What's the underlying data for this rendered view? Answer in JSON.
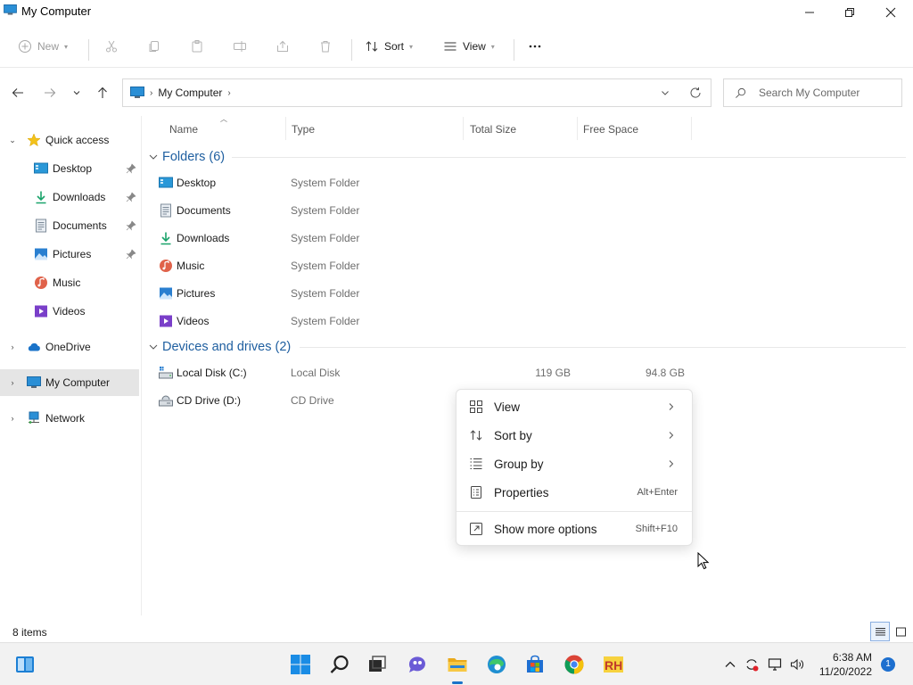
{
  "window": {
    "title": "My Computer",
    "icon": "computer-icon"
  },
  "toolbar": {
    "new_label": "New",
    "sort_label": "Sort",
    "view_label": "View",
    "more_label": "···"
  },
  "address": {
    "location": "My Computer",
    "search_placeholder": "Search My Computer"
  },
  "sidebar": {
    "quick_access": "Quick access",
    "items": [
      {
        "label": "Desktop",
        "icon": "desktop-icon",
        "pinned": true
      },
      {
        "label": "Downloads",
        "icon": "downloads-icon",
        "pinned": true
      },
      {
        "label": "Documents",
        "icon": "documents-icon",
        "pinned": true
      },
      {
        "label": "Pictures",
        "icon": "pictures-icon",
        "pinned": true
      },
      {
        "label": "Music",
        "icon": "music-icon",
        "pinned": false
      },
      {
        "label": "Videos",
        "icon": "videos-icon",
        "pinned": false
      }
    ],
    "onedrive": "OneDrive",
    "my_computer": "My Computer",
    "network": "Network"
  },
  "columns": {
    "name": "Name",
    "type": "Type",
    "total_size": "Total Size",
    "free_space": "Free Space"
  },
  "groups": {
    "folders": "Folders (6)",
    "drives": "Devices and drives (2)"
  },
  "folders": [
    {
      "name": "Desktop",
      "type": "System Folder",
      "icon": "desktop-icon"
    },
    {
      "name": "Documents",
      "type": "System Folder",
      "icon": "documents-icon"
    },
    {
      "name": "Downloads",
      "type": "System Folder",
      "icon": "downloads-icon"
    },
    {
      "name": "Music",
      "type": "System Folder",
      "icon": "music-icon"
    },
    {
      "name": "Pictures",
      "type": "System Folder",
      "icon": "pictures-icon"
    },
    {
      "name": "Videos",
      "type": "System Folder",
      "icon": "videos-icon"
    }
  ],
  "drives": [
    {
      "name": "Local Disk (C:)",
      "type": "Local Disk",
      "total": "119 GB",
      "free": "94.8 GB",
      "icon": "hard-disk-icon"
    },
    {
      "name": "CD Drive (D:)",
      "type": "CD Drive",
      "total": "",
      "free": "",
      "icon": "cd-drive-icon"
    }
  ],
  "context_menu": {
    "view": "View",
    "sort_by": "Sort by",
    "group_by": "Group by",
    "properties": "Properties",
    "properties_shortcut": "Alt+Enter",
    "show_more": "Show more options",
    "show_more_shortcut": "Shift+F10"
  },
  "status": {
    "item_count": "8 items"
  },
  "taskbar": {
    "time": "6:38 AM",
    "date": "11/20/2022",
    "notifications": "1"
  },
  "colors": {
    "accent": "#1f5fa0",
    "selection": "#e5e5e5",
    "taskbar": "#f2f2f2"
  }
}
